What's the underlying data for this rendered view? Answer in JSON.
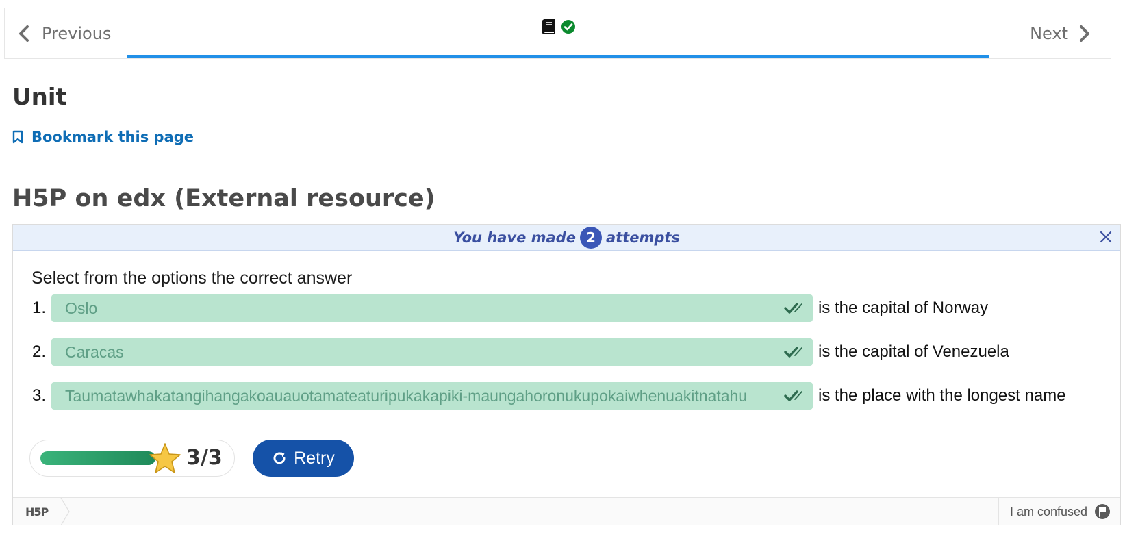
{
  "nav": {
    "previous_label": "Previous",
    "next_label": "Next",
    "icons": [
      "book-icon",
      "check-circle-icon"
    ]
  },
  "unit": {
    "title": "Unit",
    "bookmark_label": "Bookmark this page"
  },
  "block": {
    "title": "H5P on edx (External resource)"
  },
  "attempts": {
    "prefix": "You have made",
    "count": "2",
    "suffix": "attempts"
  },
  "quiz": {
    "question": "Select from the options the correct answer",
    "items": [
      {
        "number": "1.",
        "answer": "Oslo",
        "suffix": "is the capital of Norway"
      },
      {
        "number": "2.",
        "answer": "Caracas",
        "suffix": "is the capital of Venezuela"
      },
      {
        "number": "3.",
        "answer": "Taumatawhakatangihangakoauauotamateaturipukakapiki-maungahoronukupokaiwhenuakitnatahu",
        "suffix": "is the place with the longest name"
      }
    ],
    "score": {
      "earned": "3",
      "separator": "/",
      "max": "3",
      "fill_fraction": 1.0
    },
    "retry_label": "Retry"
  },
  "footer": {
    "logo_text": "H5P",
    "confused_label": "I am confused"
  },
  "colors": {
    "accent_blue": "#2190e8",
    "correct_bg": "#b9e4cf",
    "retry_bg": "#1552a8",
    "link": "#0f6db5"
  }
}
